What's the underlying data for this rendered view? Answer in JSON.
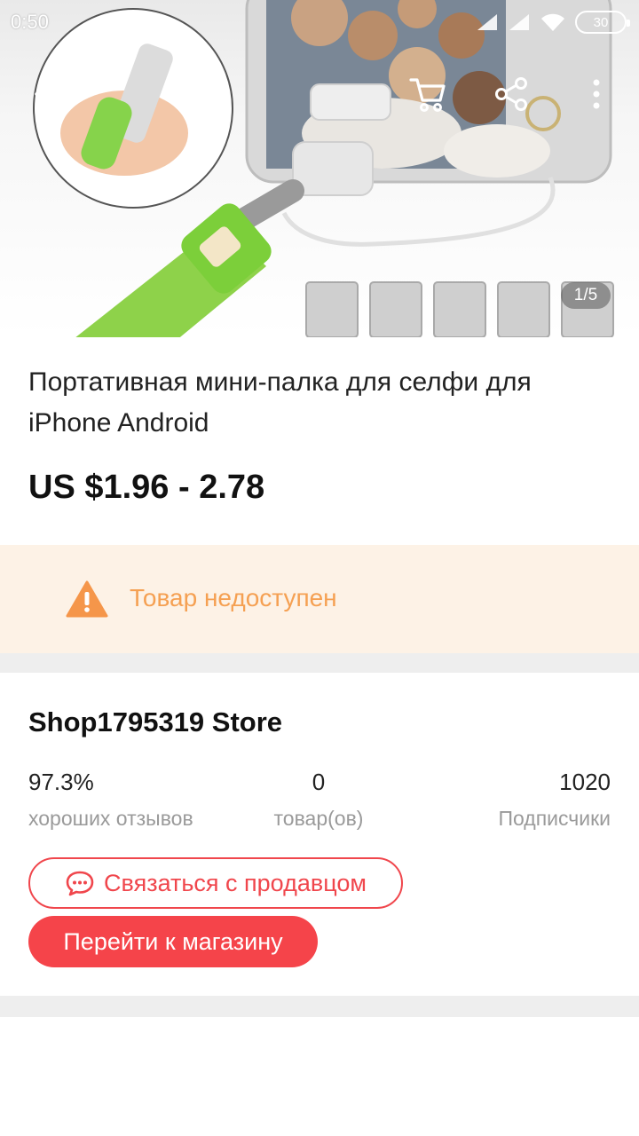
{
  "status_bar": {
    "time": "0:50",
    "battery": "30",
    "icons": [
      "signal-icon",
      "signal-icon",
      "wifi-icon",
      "battery-icon"
    ]
  },
  "gallery": {
    "counter": "1/5",
    "image_description_icon": "product-photo"
  },
  "top_actions": {
    "icons": [
      "back-arrow-icon",
      "cart-icon",
      "share-icon",
      "more-vert-icon"
    ]
  },
  "product": {
    "title": "Портативная мини-палка для селфи для iPhone Android",
    "price": "US $1.96 - 2.78"
  },
  "availability": {
    "message": "Товар недоступен",
    "icon": "warning-icon",
    "color": "#f5a052"
  },
  "store": {
    "name": "Shop1795319 Store",
    "stats": [
      {
        "value": "97.3%",
        "label": "хороших отзывов"
      },
      {
        "value": "0",
        "label": "товар(ов)"
      },
      {
        "value": "1020",
        "label": "Подписчики"
      }
    ],
    "contact_label": "Связаться с продавцом",
    "visit_label": "Перейти к магазину",
    "accent_color": "#f5444a"
  }
}
